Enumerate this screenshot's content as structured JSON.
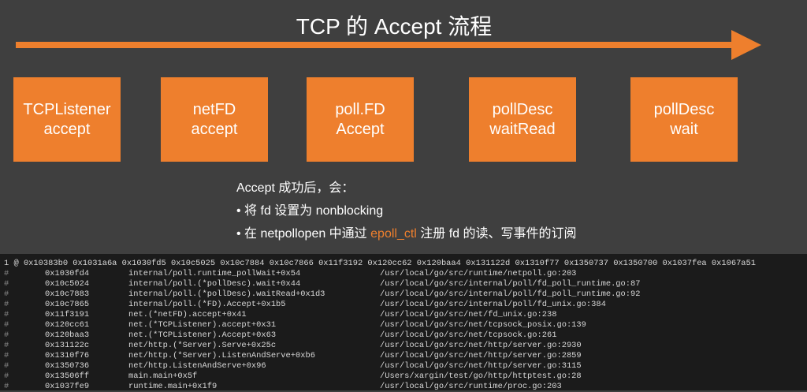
{
  "title": "TCP 的 Accept 流程",
  "colors": {
    "accent": "#ee7f2d",
    "background": "#3f3f3f",
    "terminal": "#1b1b1b"
  },
  "boxes": [
    {
      "line1": "TCPListener",
      "line2": "accept"
    },
    {
      "line1": "netFD",
      "line2": "accept"
    },
    {
      "line1": "poll.FD",
      "line2": "Accept"
    },
    {
      "line1": "pollDesc",
      "line2": "waitRead"
    },
    {
      "line1": "pollDesc",
      "line2": "wait"
    }
  ],
  "notes": {
    "heading": "Accept 成功后，会：",
    "bullet1": "• 将 fd 设置为 nonblocking",
    "bullet2_pre": "• 在 netpollopen 中通过 ",
    "bullet2_hl": "epoll_ctl",
    "bullet2_post": " 注册 fd 的读、写事件的订阅"
  },
  "terminal": {
    "header": "1 @ 0x10383b0 0x1031a6a 0x1030fd5 0x10c5025 0x10c7884 0x10c7866 0x11f3192 0x120cc62 0x120baa4 0x131122d 0x1310f77 0x1350737 0x1350700 0x1037fea 0x1067a51",
    "rows": [
      {
        "mark": "#",
        "addr": "0x1030fd4",
        "func": "internal/poll.runtime_pollWait+0x54",
        "path": "/usr/local/go/src/runtime/netpoll.go:203"
      },
      {
        "mark": "#",
        "addr": "0x10c5024",
        "func": "internal/poll.(*pollDesc).wait+0x44",
        "path": "/usr/local/go/src/internal/poll/fd_poll_runtime.go:87"
      },
      {
        "mark": "#",
        "addr": "0x10c7883",
        "func": "internal/poll.(*pollDesc).waitRead+0x1d3",
        "path": "/usr/local/go/src/internal/poll/fd_poll_runtime.go:92"
      },
      {
        "mark": "#",
        "addr": "0x10c7865",
        "func": "internal/poll.(*FD).Accept+0x1b5",
        "path": "/usr/local/go/src/internal/poll/fd_unix.go:384"
      },
      {
        "mark": "#",
        "addr": "0x11f3191",
        "func": "net.(*netFD).accept+0x41",
        "path": "/usr/local/go/src/net/fd_unix.go:238"
      },
      {
        "mark": "#",
        "addr": "0x120cc61",
        "func": "net.(*TCPListener).accept+0x31",
        "path": "/usr/local/go/src/net/tcpsock_posix.go:139"
      },
      {
        "mark": "#",
        "addr": "0x120baa3",
        "func": "net.(*TCPListener).Accept+0x63",
        "path": "/usr/local/go/src/net/tcpsock.go:261"
      },
      {
        "mark": "#",
        "addr": "0x131122c",
        "func": "net/http.(*Server).Serve+0x25c",
        "path": "/usr/local/go/src/net/http/server.go:2930"
      },
      {
        "mark": "#",
        "addr": "0x1310f76",
        "func": "net/http.(*Server).ListenAndServe+0xb6",
        "path": "/usr/local/go/src/net/http/server.go:2859"
      },
      {
        "mark": "#",
        "addr": "0x1350736",
        "func": "net/http.ListenAndServe+0x96",
        "path": "/usr/local/go/src/net/http/server.go:3115"
      },
      {
        "mark": "#",
        "addr": "0x13506ff",
        "func": "main.main+0x5f",
        "path": "/Users/xargin/test/go/http/httptest.go:28"
      },
      {
        "mark": "#",
        "addr": "0x1037fe9",
        "func": "runtime.main+0x1f9",
        "path": "/usr/local/go/src/runtime/proc.go:203"
      }
    ]
  }
}
